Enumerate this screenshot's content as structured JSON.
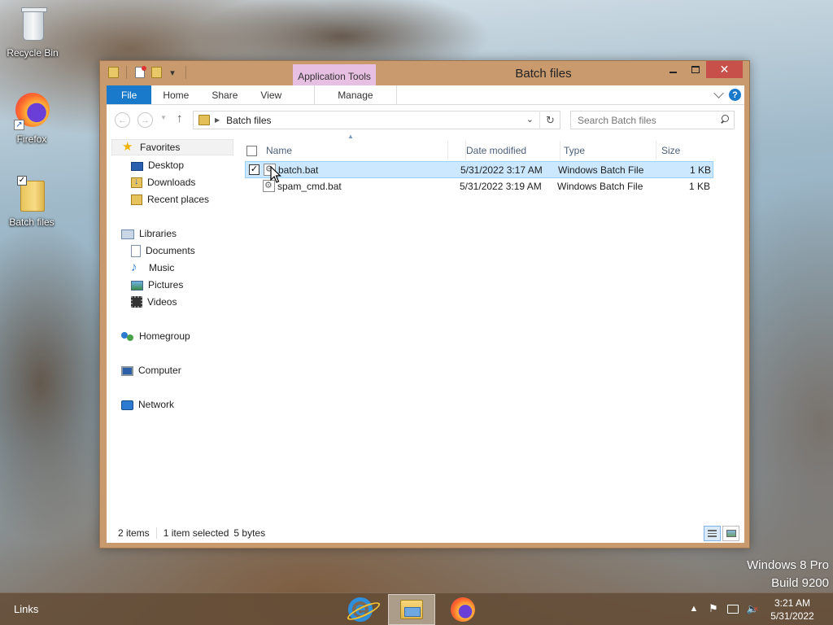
{
  "desktop": {
    "icons": [
      {
        "label": "Recycle Bin",
        "icon": "recycle-bin-icon"
      },
      {
        "label": "Firefox",
        "icon": "firefox-icon"
      },
      {
        "label": "Batch files",
        "icon": "folder-icon"
      }
    ],
    "watermark": {
      "line1": "Windows 8 Pro",
      "line2": "Build 9200"
    }
  },
  "window": {
    "title": "Batch files",
    "contextual_tab_group": "Application Tools",
    "ribbon_tabs": [
      "File",
      "Home",
      "Share",
      "View"
    ],
    "contextual_tab": "Manage",
    "help_label": "?"
  },
  "navigation": {
    "address": "Batch files",
    "search_placeholder": "Search Batch files"
  },
  "nav_pane": {
    "favorites": {
      "label": "Favorites",
      "items": [
        "Desktop",
        "Downloads",
        "Recent places"
      ]
    },
    "libraries": {
      "label": "Libraries",
      "items": [
        "Documents",
        "Music",
        "Pictures",
        "Videos"
      ]
    },
    "homegroup": "Homegroup",
    "computer": "Computer",
    "network": "Network"
  },
  "file_list": {
    "columns": [
      "Name",
      "Date modified",
      "Type",
      "Size"
    ],
    "rows": [
      {
        "name": "batch.bat",
        "date": "5/31/2022 3:17 AM",
        "type": "Windows Batch File",
        "size": "1 KB",
        "selected": true,
        "checked": "✓"
      },
      {
        "name": "spam_cmd.bat",
        "date": "5/31/2022 3:19 AM",
        "type": "Windows Batch File",
        "size": "1 KB",
        "selected": false,
        "checked": ""
      }
    ]
  },
  "status": {
    "items_count": "2 items",
    "selection": "1 item selected",
    "size": "5 bytes"
  },
  "taskbar": {
    "links_label": "Links",
    "apps": [
      "Internet Explorer",
      "File Explorer",
      "Firefox"
    ],
    "time": "3:21 AM",
    "date": "5/31/2022"
  },
  "colors": {
    "window_frame": "#c89a6e",
    "file_tab": "#1979ca",
    "contextual_tab": "#e7bfe2",
    "close_button": "#c7504a",
    "selection": "#cce8ff"
  }
}
